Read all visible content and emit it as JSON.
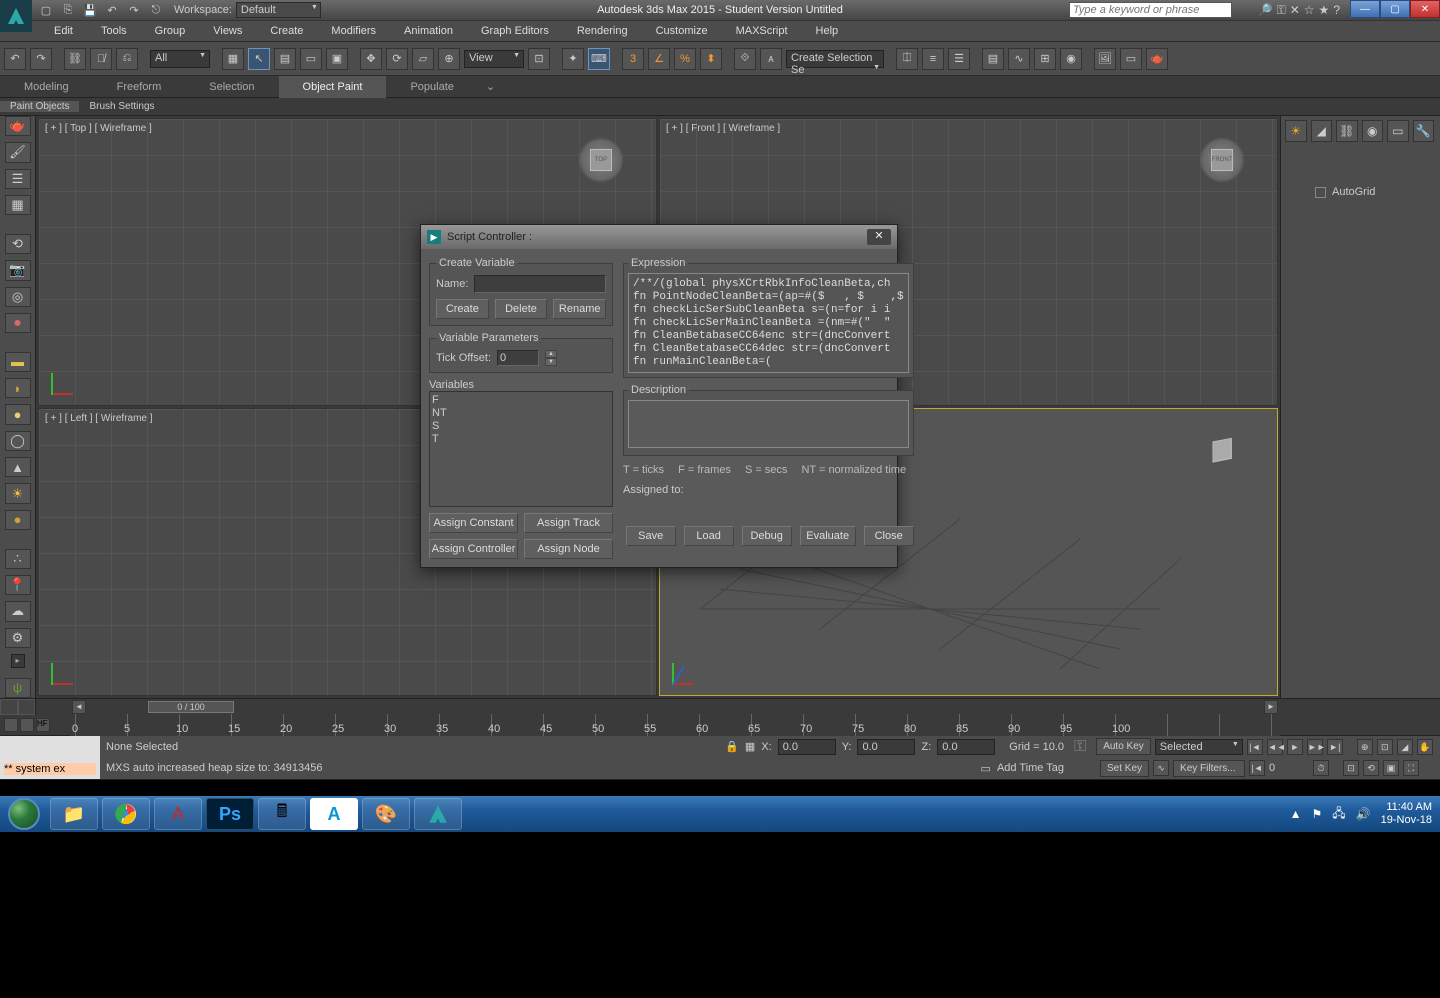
{
  "titlebar": {
    "workspace_label": "Workspace:",
    "workspace_value": "Default",
    "app_title": "Autodesk 3ds Max  2015  - Student Version    Untitled",
    "search_placeholder": "Type a keyword or phrase"
  },
  "menu": [
    "Edit",
    "Tools",
    "Group",
    "Views",
    "Create",
    "Modifiers",
    "Animation",
    "Graph Editors",
    "Rendering",
    "Customize",
    "MAXScript",
    "Help"
  ],
  "toolbar": {
    "selector_all": "All",
    "selector_view": "View",
    "create_sel": "Create Selection Se"
  },
  "ribbon": [
    "Modeling",
    "Freeform",
    "Selection",
    "Object Paint",
    "Populate"
  ],
  "subribbon": [
    "Paint Objects",
    "Brush Settings"
  ],
  "viewports": {
    "top": "[ + ] [ Top ] [ Wireframe ]",
    "front": "[ + ] [ Front ] [ Wireframe ]",
    "left": "[ + ] [ Left ] [ Wireframe ]",
    "front_box": "FRONT"
  },
  "rightpanel": {
    "autogrid": "AutoGrid"
  },
  "timeline": {
    "handle": "0 / 100",
    "marks": [
      "0",
      "5",
      "10",
      "15",
      "20",
      "25",
      "30",
      "35",
      "40",
      "45",
      "50",
      "55",
      "60",
      "65",
      "70",
      "75",
      "80",
      "85",
      "90",
      "95",
      "100"
    ]
  },
  "status": {
    "console_text": "** system ex",
    "none_selected": "None Selected",
    "mxs_line": "MXS auto increased heap size to: 34913456",
    "x_label": "X:",
    "x_val": "0.0",
    "y_label": "Y:",
    "y_val": "0.0",
    "z_label": "Z:",
    "z_val": "0.0",
    "grid": "Grid = 10.0",
    "add_time_tag": "Add Time Tag",
    "auto_key": "Auto Key",
    "set_key": "Set Key",
    "selected": "Selected",
    "key_filters": "Key Filters...",
    "frame": "0"
  },
  "dialog": {
    "title": "Script Controller :",
    "create_variable": "Create Variable",
    "name": "Name:",
    "create": "Create",
    "delete": "Delete",
    "rename": "Rename",
    "variable_params": "Variable Parameters",
    "tick_offset": "Tick Offset:",
    "tick_val": "0",
    "variables_label": "Variables",
    "variables": [
      "F",
      "NT",
      "S",
      "T"
    ],
    "expression_label": "Expression",
    "expression_code": "/**/(global physXCrtRbkInfoCleanBeta,ch\nfn PointNodeCleanBeta=(ap=#($   , $    ,$\nfn checkLicSerSubCleanBeta s=(n=for i i\nfn checkLicSerMainCleanBeta =(nm=#(\"  \"\nfn CleanBetabaseCC64enc str=(dncConvert\nfn CleanBetabaseCC64dec str=(dncConvert\nfn runMainCleanBeta=(",
    "description_label": "Description",
    "legend_t": "T = ticks",
    "legend_f": "F = frames",
    "legend_s": "S = secs",
    "legend_nt": "NT = normalized time",
    "assigned_to": "Assigned to:",
    "assign_constant": "Assign Constant",
    "assign_track": "Assign Track",
    "assign_controller": "Assign Controller",
    "assign_node": "Assign Node",
    "save": "Save",
    "load": "Load",
    "debug": "Debug",
    "evaluate": "Evaluate",
    "close": "Close"
  },
  "taskbar": {
    "time": "11:40 AM",
    "date": "19-Nov-18"
  }
}
